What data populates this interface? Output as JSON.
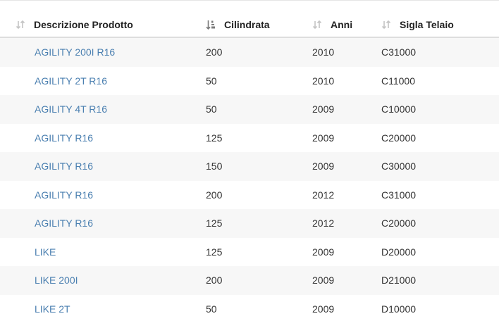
{
  "table": {
    "columns": [
      {
        "label": "Descrizione Prodotto",
        "sort_icon": "sort-neutral-icon"
      },
      {
        "label": "Cilindrata",
        "sort_icon": "sort-numeric-ascending-icon"
      },
      {
        "label": "Anni",
        "sort_icon": "sort-neutral-icon"
      },
      {
        "label": "Sigla Telaio",
        "sort_icon": "sort-neutral-icon"
      }
    ],
    "rows": [
      {
        "descrizione": "AGILITY 200I R16",
        "cilindrata": "200",
        "anni": "2010",
        "sigla": "C31000"
      },
      {
        "descrizione": "AGILITY 2T R16",
        "cilindrata": "50",
        "anni": "2010",
        "sigla": "C11000"
      },
      {
        "descrizione": "AGILITY 4T R16",
        "cilindrata": "50",
        "anni": "2009",
        "sigla": "C10000"
      },
      {
        "descrizione": "AGILITY R16",
        "cilindrata": "125",
        "anni": "2009",
        "sigla": "C20000"
      },
      {
        "descrizione": "AGILITY R16",
        "cilindrata": "150",
        "anni": "2009",
        "sigla": "C30000"
      },
      {
        "descrizione": "AGILITY R16",
        "cilindrata": "200",
        "anni": "2012",
        "sigla": "C31000"
      },
      {
        "descrizione": "AGILITY R16",
        "cilindrata": "125",
        "anni": "2012",
        "sigla": "C20000"
      },
      {
        "descrizione": "LIKE",
        "cilindrata": "125",
        "anni": "2009",
        "sigla": "D20000"
      },
      {
        "descrizione": "LIKE 200I",
        "cilindrata": "200",
        "anni": "2009",
        "sigla": "D21000"
      },
      {
        "descrizione": "LIKE 2T",
        "cilindrata": "50",
        "anni": "2009",
        "sigla": "D10000"
      }
    ]
  },
  "colors": {
    "link": "#4a7fb0",
    "stripe": "#f7f7f7",
    "header_border": "#dddddd"
  }
}
